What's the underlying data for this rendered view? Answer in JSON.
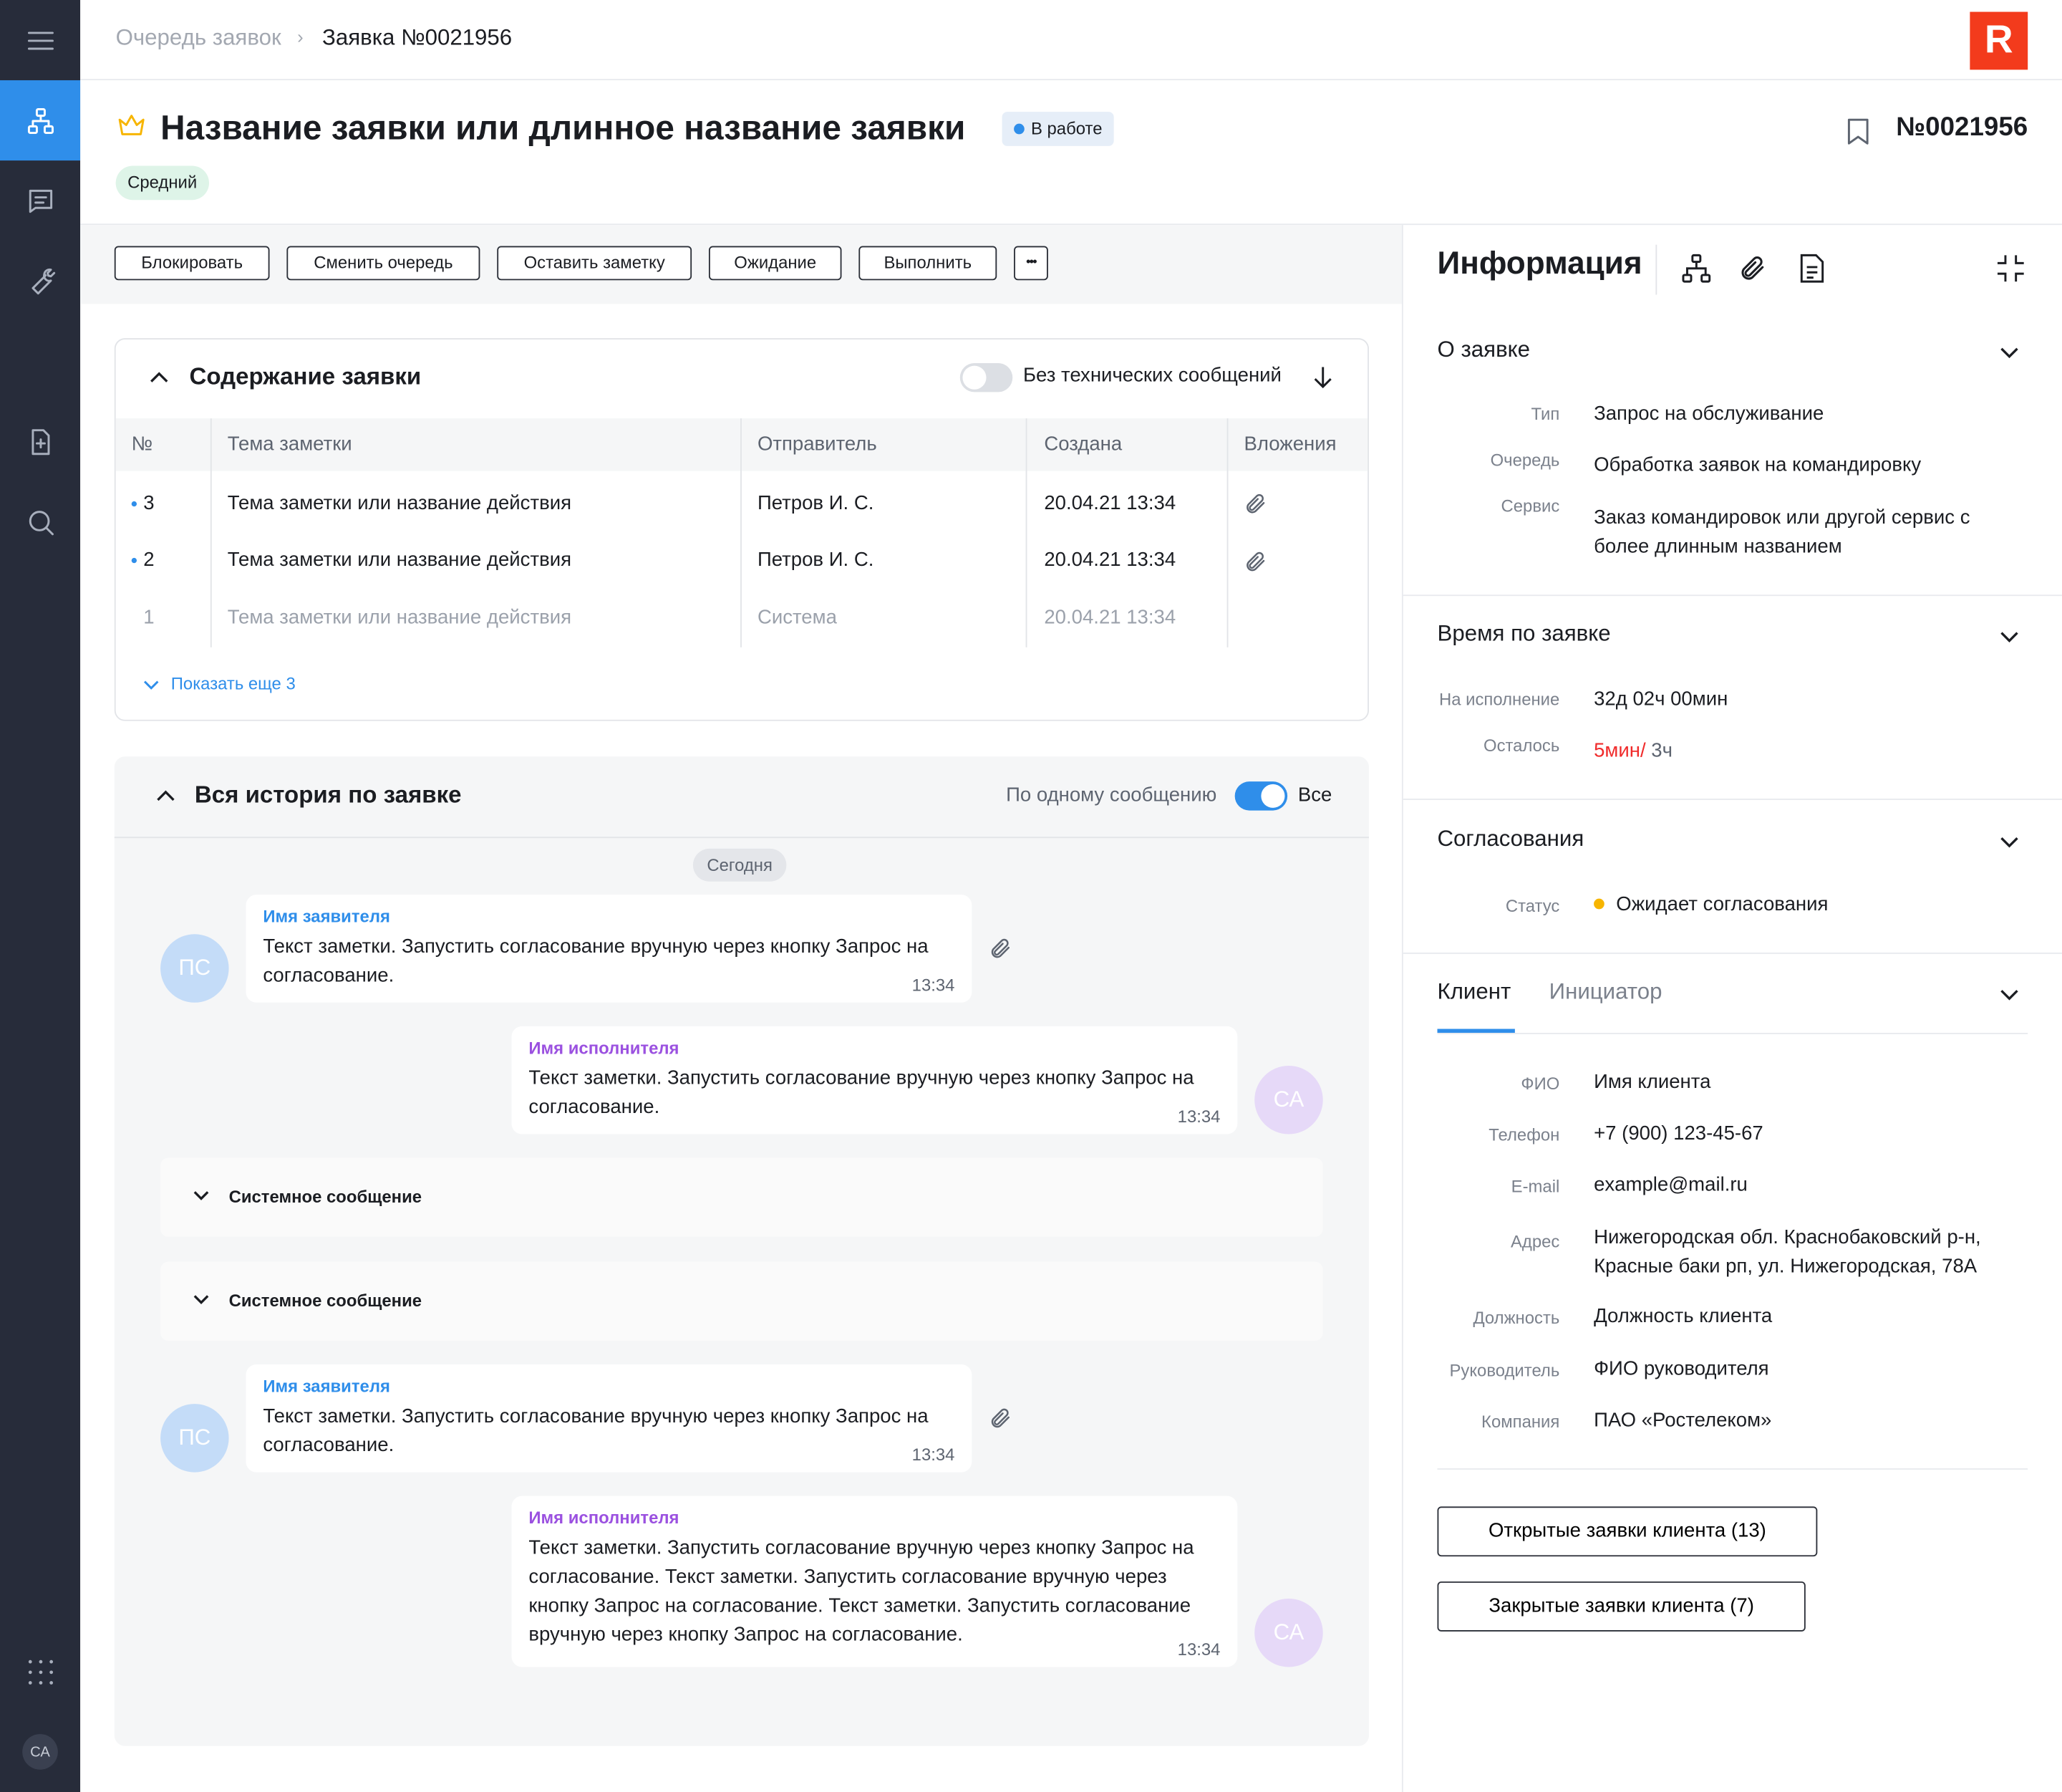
{
  "breadcrumb": {
    "parent": "Очередь заявок",
    "current": "Заявка №0021956"
  },
  "request": {
    "title": "Название заявки или длинное название заявки",
    "status": "В работе",
    "priority": "Средний",
    "number": "№0021956"
  },
  "toolbar": {
    "block": "Блокировать",
    "change_queue": "Сменить очередь",
    "leave_note": "Оставить заметку",
    "waiting": "Ожидание",
    "complete": "Выполнить",
    "more": "•••"
  },
  "content": {
    "title": "Содержание заявки",
    "toggle_label": "Без технических сообщений",
    "columns": [
      "№",
      "Тема заметки",
      "Отправитель",
      "Создана",
      "Вложения"
    ],
    "rows": [
      {
        "num": "3",
        "topic": "Тема заметки или название действия",
        "sender": "Петров И. С.",
        "created": "20.04.21 13:34"
      },
      {
        "num": "2",
        "topic": "Тема заметки или название действия",
        "sender": "Петров И. С.",
        "created": "20.04.21 13:34"
      },
      {
        "num": "1",
        "topic": "Тема заметки или название действия",
        "sender": "Система",
        "created": "20.04.21 13:34"
      }
    ],
    "show_more": "Показать еще 3"
  },
  "history": {
    "title": "Вся история по заявке",
    "toggle_left": "По одному сообщению",
    "toggle_right": "Все",
    "today": "Сегодня",
    "messages": [
      {
        "author": "Имя заявителя",
        "text": "Текст заметки. Запустить согласование вручную через кнопку Запрос на согласование.",
        "time": "13:34",
        "initials": "ПС"
      },
      {
        "author": "Имя исполнителя",
        "text": "Текст заметки. Запустить согласование вручную через кнопку Запрос на согласование.",
        "time": "13:34",
        "initials": "СА"
      },
      {
        "author": "Имя заявителя",
        "text": "Текст заметки. Запустить согласование вручную через кнопку Запрос на согласование.",
        "time": "13:34",
        "initials": "ПС"
      },
      {
        "author": "Имя исполнителя",
        "text": "Текст заметки. Запустить согласование вручную через кнопку Запрос на согласование. Текст заметки. Запустить согласование вручную через кнопку Запрос на согласование. Текст заметки. Запустить согласование вручную через кнопку Запрос на согласование.",
        "time": "13:34",
        "initials": "СА"
      }
    ],
    "system_message": "Системное сообщение"
  },
  "info": {
    "title": "Информация",
    "about": {
      "title": "О заявке",
      "type_label": "Тип",
      "type": "Запрос на обслуживание",
      "queue_label": "Очередь",
      "queue": "Обработка заявок на командировку",
      "service_label": "Сервис",
      "service": "Заказ командировок или другой сервис с более длинным названием"
    },
    "time": {
      "title": "Время по заявке",
      "exec_label": "На исполнение",
      "exec": "32д 02ч 00мин",
      "left_label": "Осталось",
      "left_red": "5мин/",
      "left_total": " 3ч"
    },
    "approvals": {
      "title": "Согласования",
      "status_label": "Статус",
      "status": "Ожидает согласования"
    },
    "client": {
      "tab_client": "Клиент",
      "tab_initiator": "Инициатор",
      "fio_label": "ФИО",
      "fio": "Имя клиента",
      "phone_label": "Телефон",
      "phone": "+7 (900) 123-45-67",
      "email_label": "E-mail",
      "email": "example@mail.ru",
      "address_label": "Адрес",
      "address": "Нижегородская обл. Краснобаковский р-н, Красные баки рп, ул. Нижегородская, 78А",
      "position_label": "Должность",
      "position": "Должность клиента",
      "manager_label": "Руководитель",
      "manager": "ФИО руководителя",
      "company_label": "Компания",
      "company": "ПАО «Ростелеком»",
      "open_requests": "Открытые заявки клиента (13)",
      "closed_requests": "Закрытые заявки клиента (7)"
    }
  },
  "user_initials": "СА",
  "colors": {
    "accent": "#2f8eea",
    "sidebar": "#272c3a",
    "logo": "#f33b1c",
    "danger": "#f02b2b",
    "warning": "#f7b500",
    "author_blue": "#2f8eea",
    "author_purple": "#9b51e0"
  }
}
